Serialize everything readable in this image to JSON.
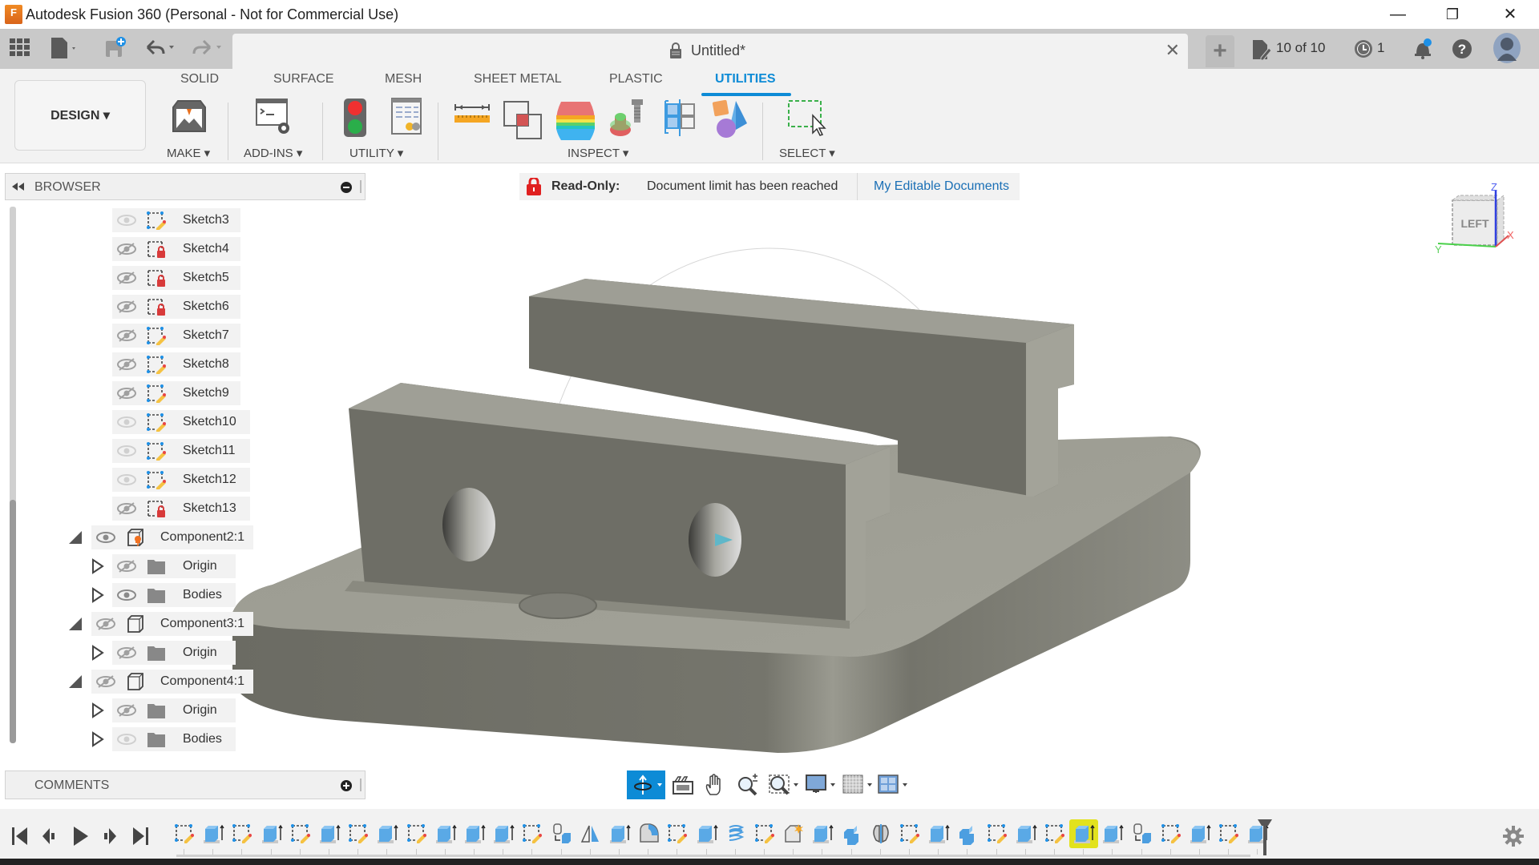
{
  "window": {
    "title": "Autodesk Fusion 360 (Personal - Not for Commercial Use)",
    "logo_letter": "F",
    "minimize": "—",
    "restore": "❐",
    "close": "✕"
  },
  "quick_access": {
    "data_panel_icon": "grid-icon",
    "file_icon": "file-icon",
    "save_icon": "save-icon",
    "undo_icon": "undo-icon",
    "redo_icon": "redo-icon"
  },
  "document_tab": {
    "title": "Untitled*",
    "close": "✕",
    "new_tab": "+"
  },
  "header_right": {
    "doc_count": "10 of 10",
    "jobs_count": "1",
    "notification_dot_color": "#1e90e6"
  },
  "ribbon": {
    "workspace": "DESIGN",
    "tabs": [
      {
        "label": "SOLID",
        "active": false
      },
      {
        "label": "SURFACE",
        "active": false
      },
      {
        "label": "MESH",
        "active": false
      },
      {
        "label": "SHEET METAL",
        "active": false
      },
      {
        "label": "PLASTIC",
        "active": false
      },
      {
        "label": "UTILITIES",
        "active": true
      }
    ],
    "groups": [
      {
        "label": "MAKE"
      },
      {
        "label": "ADD-INS"
      },
      {
        "label": "UTILITY"
      },
      {
        "label": "INSPECT"
      },
      {
        "label": "SELECT"
      }
    ],
    "accent_color": "#0d8bd6"
  },
  "browser": {
    "title": "BROWSER",
    "items": [
      {
        "label": "Sketch3",
        "visible": true,
        "type": "sketch"
      },
      {
        "label": "Sketch4",
        "visible": false,
        "type": "sketch-locked"
      },
      {
        "label": "Sketch5",
        "visible": false,
        "type": "sketch-locked"
      },
      {
        "label": "Sketch6",
        "visible": false,
        "type": "sketch-locked"
      },
      {
        "label": "Sketch7",
        "visible": false,
        "type": "sketch"
      },
      {
        "label": "Sketch8",
        "visible": false,
        "type": "sketch"
      },
      {
        "label": "Sketch9",
        "visible": false,
        "type": "sketch"
      },
      {
        "label": "Sketch10",
        "visible": true,
        "type": "sketch"
      },
      {
        "label": "Sketch11",
        "visible": true,
        "type": "sketch"
      },
      {
        "label": "Sketch12",
        "visible": true,
        "type": "sketch"
      },
      {
        "label": "Sketch13",
        "visible": false,
        "type": "sketch-locked"
      },
      {
        "label": "Component2:1",
        "visible": true,
        "type": "component-active"
      },
      {
        "label": "Origin",
        "visible": false,
        "type": "folder"
      },
      {
        "label": "Bodies",
        "visible": true,
        "type": "folder"
      },
      {
        "label": "Component3:1",
        "visible": false,
        "type": "component"
      },
      {
        "label": "Origin",
        "visible": false,
        "type": "folder"
      },
      {
        "label": "Component4:1",
        "visible": false,
        "type": "component"
      },
      {
        "label": "Origin",
        "visible": false,
        "type": "folder"
      },
      {
        "label": "Bodies",
        "visible": true,
        "type": "folder"
      }
    ]
  },
  "readonly_banner": {
    "label": "Read-Only:",
    "message": "Document limit has been reached",
    "link": "My Editable Documents"
  },
  "viewcube": {
    "face": "LEFT",
    "axis_z": "Z",
    "axis_x": "X",
    "axis_y": "Y"
  },
  "comments": {
    "title": "COMMENTS"
  },
  "nav_toolbar": {
    "items": [
      "orbit-icon",
      "look-at-icon",
      "pan-icon",
      "zoom-icon",
      "fit-icon",
      "display-settings-icon",
      "grid-icon",
      "viewports-icon"
    ]
  },
  "timeline": {
    "features": [
      "sketch",
      "extrude",
      "sketch",
      "extrude",
      "sketch",
      "extrude",
      "sketch",
      "extrude",
      "sketch",
      "extrude",
      "extrude",
      "extrude",
      "sketch",
      "move",
      "mirror",
      "extrude",
      "fillet",
      "sketch",
      "extrude",
      "coil",
      "sketch",
      "chamfer",
      "extrude",
      "combine",
      "split",
      "sketch",
      "extrude",
      "combine",
      "sketch",
      "extrude",
      "sketch",
      "extrude",
      "extrude",
      "move",
      "sketch",
      "extrude",
      "sketch",
      "extrude"
    ],
    "highlighted_index": 31,
    "highlight_color": "#e2e21e"
  }
}
